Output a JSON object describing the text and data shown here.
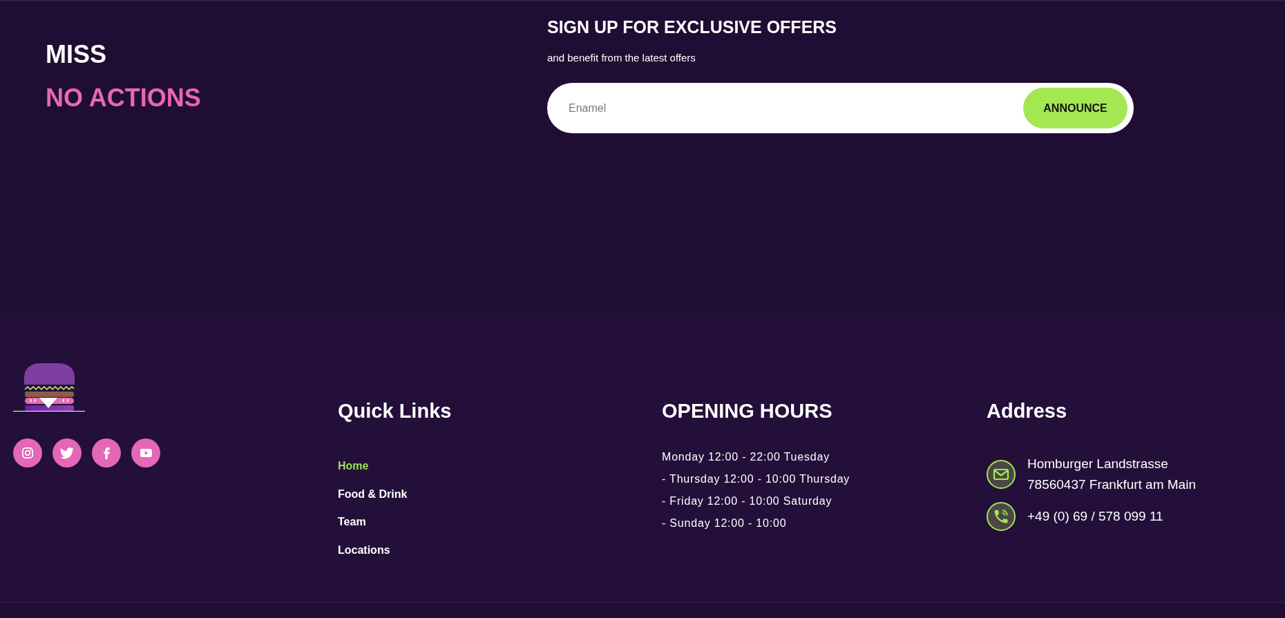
{
  "promo": {
    "lines": [
      {
        "text": "MISS",
        "kind": "plain"
      },
      {
        "text": "NO ACTIONS",
        "kind": "accent"
      }
    ]
  },
  "newsletter": {
    "title": "SIGN UP FOR EXCLUSIVE OFFERS",
    "subtitle": "and benefit from the latest offers",
    "email_field": {
      "placeholder": "Enamel"
    },
    "submit_button": {
      "label": "ANNOUNCE"
    }
  },
  "footer": {
    "quick_links": {
      "heading": "Quick Links",
      "items": [
        {
          "label": "Home",
          "selected": true
        },
        {
          "label": "Food & Drink",
          "selected": false
        },
        {
          "label": "Team",
          "selected": false
        },
        {
          "label": "Locations",
          "selected": false
        }
      ]
    },
    "opening_hours": {
      "heading": "OPENING HOURS",
      "lines": [
        "Monday 12:00 - 22:00 Tuesday",
        "- Thursday 12:00 - 10:00 Thursday",
        "- Friday 12:00 - 10:00 Saturday",
        "- Sunday 12:00 - 10:00"
      ]
    },
    "address": {
      "heading": "Address",
      "location_lines": [
        "Homburger Landstrasse",
        "78560437 Frankfurt am Main"
      ],
      "phone": "+49 (0) 69 / 578 099 11"
    }
  }
}
